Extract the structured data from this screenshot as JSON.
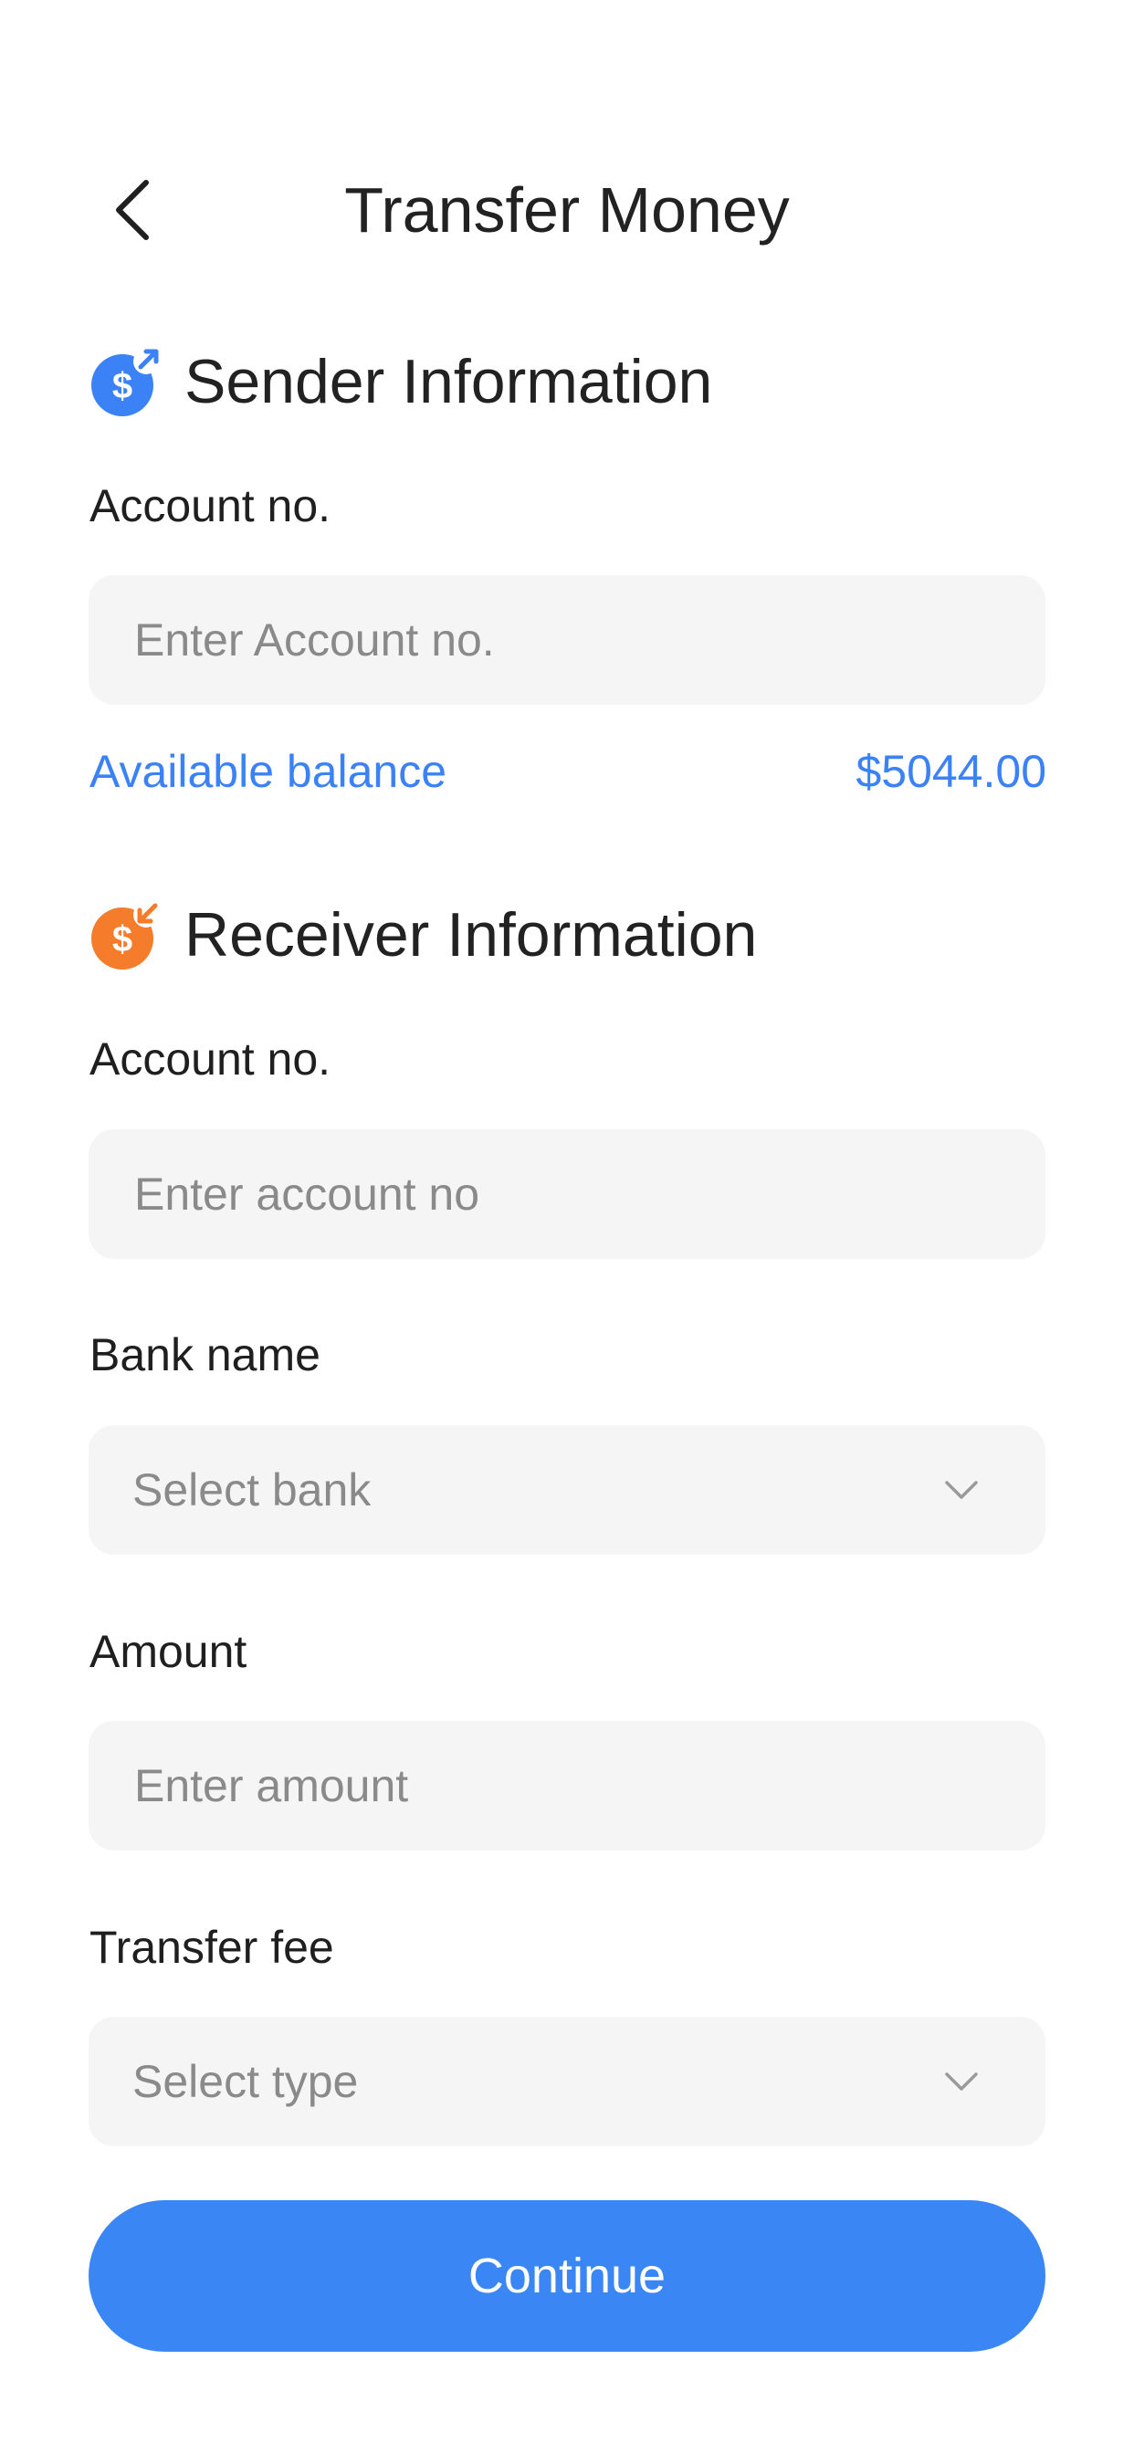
{
  "header": {
    "title": "Transfer Money",
    "back_icon": "chevron-left-icon"
  },
  "sender": {
    "title": "Sender Information",
    "icon": "money-send-icon",
    "icon_color": "#3b82f6",
    "account_label": "Account no.",
    "account_placeholder": "Enter Account no.",
    "balance_label": "Available balance",
    "balance_value": "$5044.00"
  },
  "receiver": {
    "title": "Receiver Information",
    "icon": "money-receive-icon",
    "icon_color": "#f47c2b",
    "account_label": "Account no.",
    "account_placeholder": "Enter account no",
    "bank_label": "Bank name",
    "bank_placeholder": "Select bank",
    "amount_label": "Amount",
    "amount_placeholder": "Enter amount",
    "fee_label": "Transfer fee",
    "fee_placeholder": "Select type"
  },
  "actions": {
    "continue_label": "Continue"
  },
  "colors": {
    "accent": "#3a86f5",
    "field_bg": "#f5f5f5",
    "placeholder": "#8a8a8a"
  }
}
